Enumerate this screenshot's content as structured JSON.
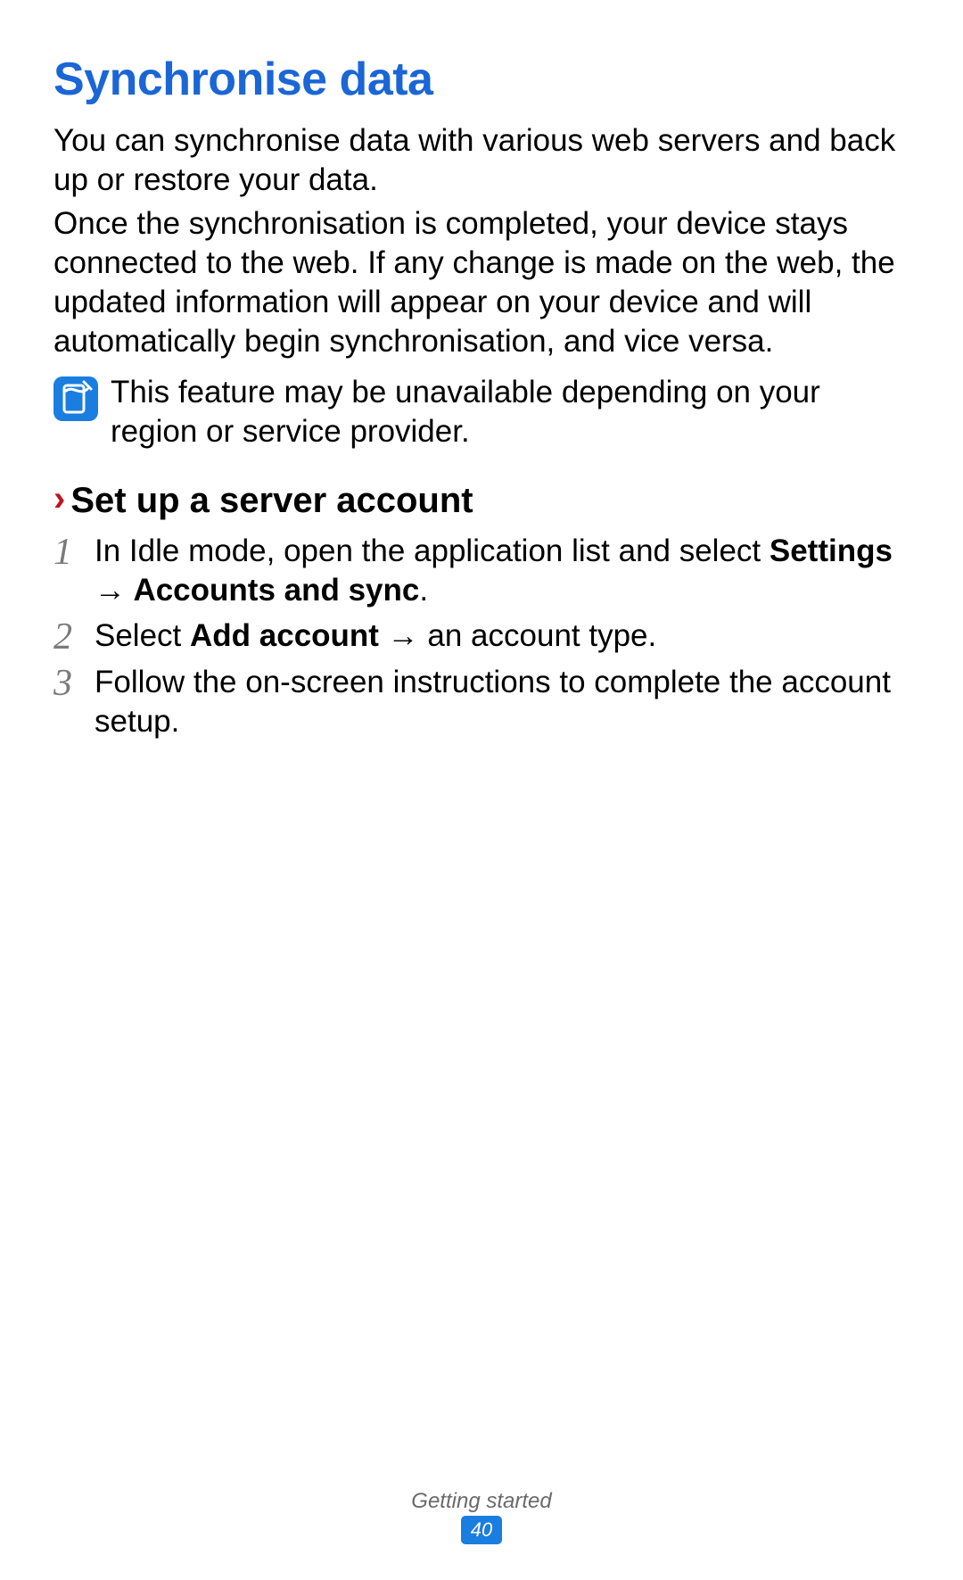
{
  "heading": "Synchronise data",
  "para1": "You can synchronise data with various web servers and back up or restore your data.",
  "para2": "Once the synchronisation is completed, your device stays connected to the web. If any change is made on the web, the updated information will appear on your device and will automatically begin synchronisation, and vice versa.",
  "note": "This feature may be unavailable depending on your region or service provider.",
  "subhead_marker": "›",
  "subhead": "Set up a server account",
  "steps": [
    {
      "num": "1",
      "pre": "In Idle mode, open the application list and select ",
      "bold1": "Settings",
      "mid": " → ",
      "bold2": "Accounts and sync",
      "post": "."
    },
    {
      "num": "2",
      "pre": "Select ",
      "bold1": "Add account",
      "mid": " → an account type.",
      "bold2": "",
      "post": ""
    },
    {
      "num": "3",
      "pre": "Follow the on-screen instructions to complete the account setup.",
      "bold1": "",
      "mid": "",
      "bold2": "",
      "post": ""
    }
  ],
  "footer_label": "Getting started",
  "page_number": "40"
}
